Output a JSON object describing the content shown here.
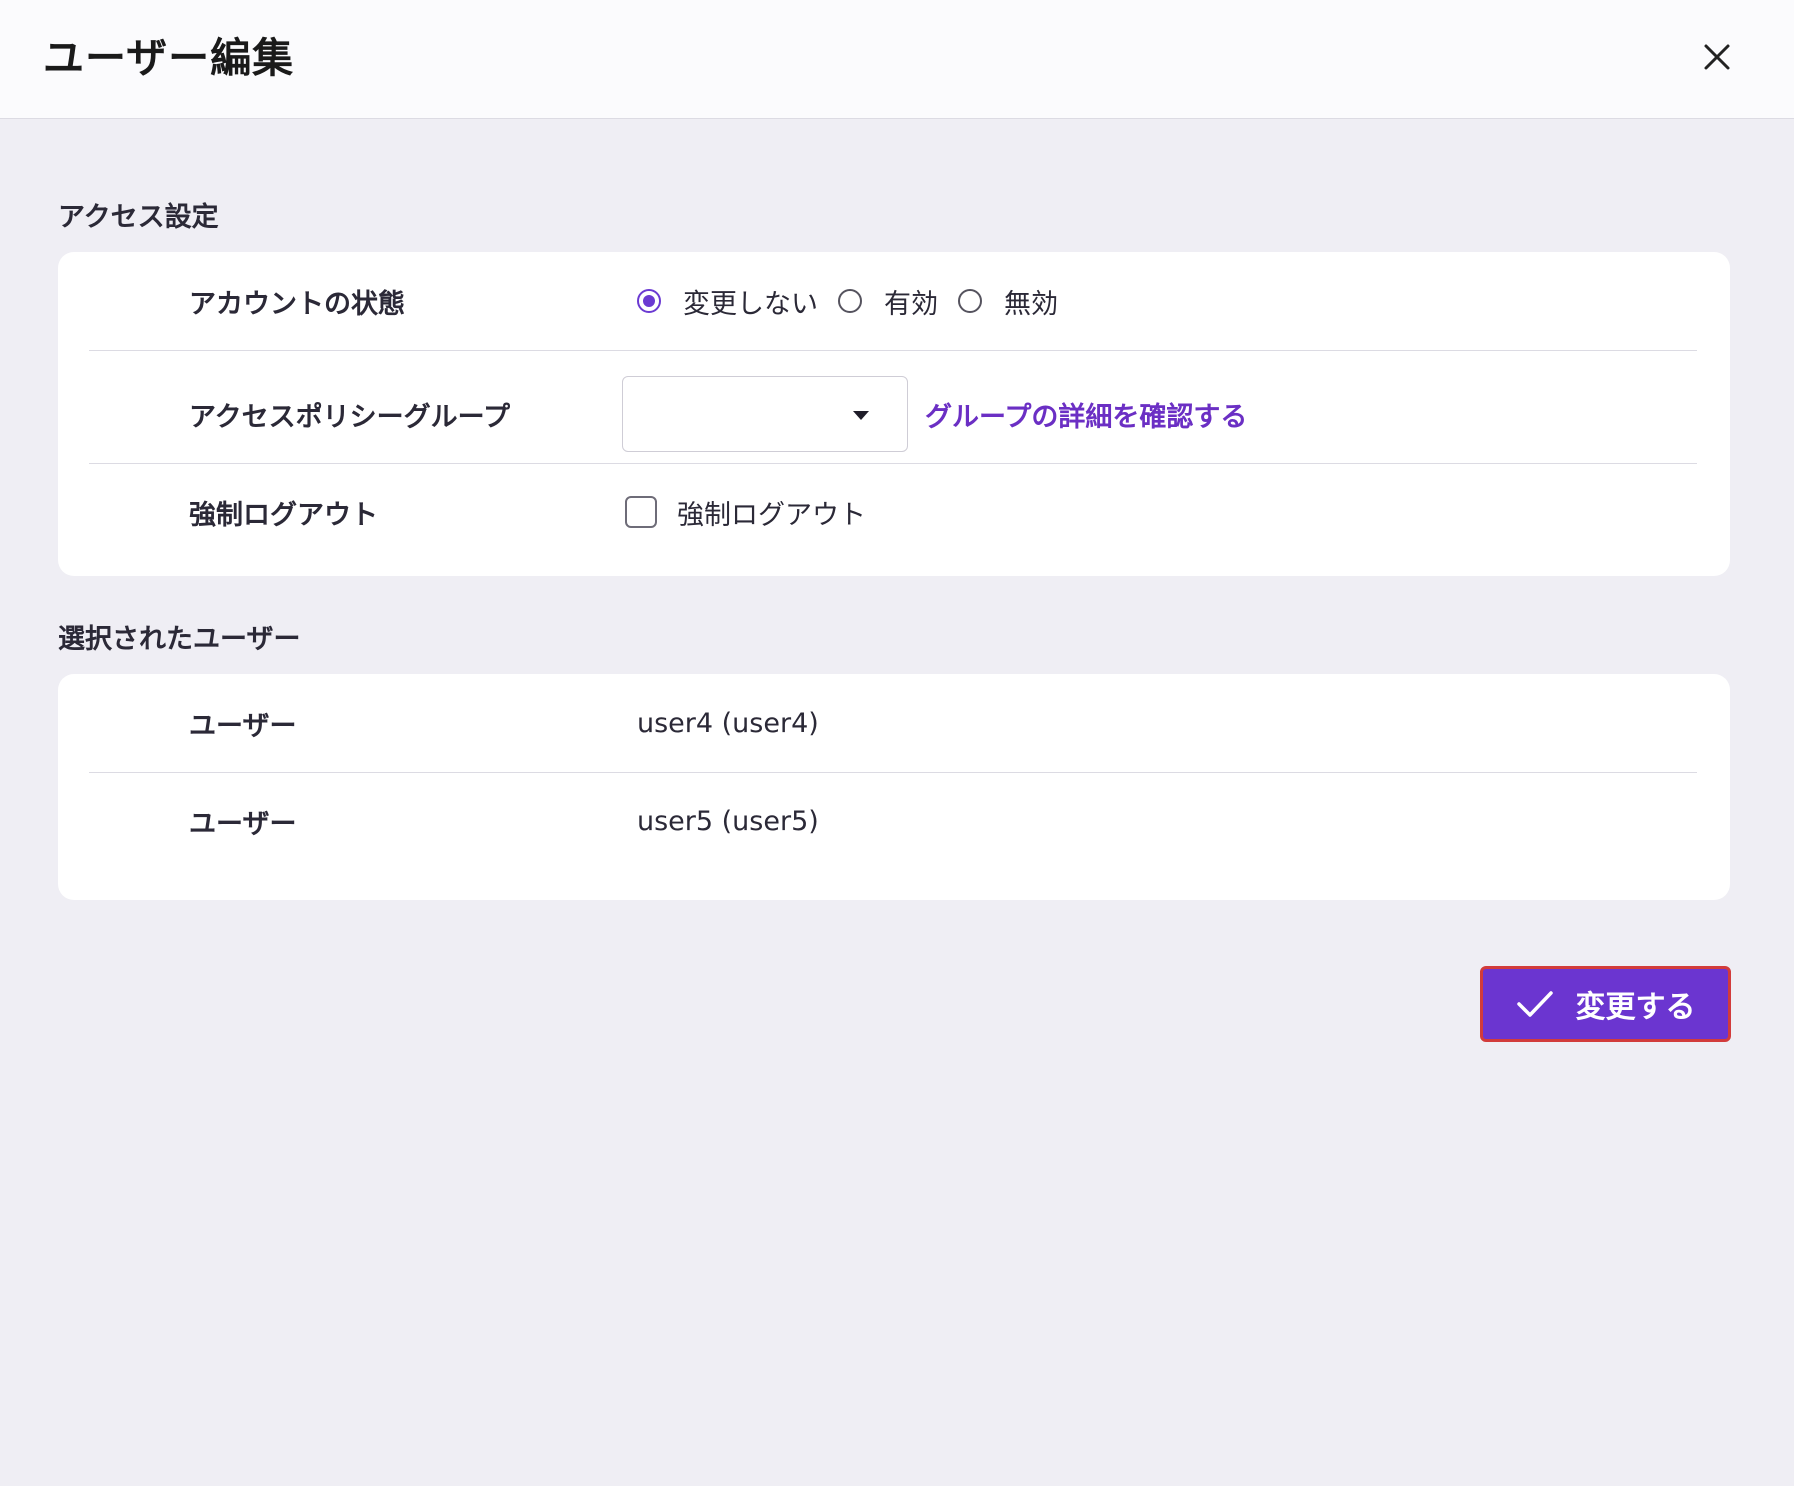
{
  "dialog": {
    "title": "ユーザー編集",
    "close_icon": "close-icon"
  },
  "access_settings": {
    "section_title": "アクセス設定",
    "account_status": {
      "label": "アカウントの状態",
      "options": [
        {
          "label": "変更しない",
          "checked": true
        },
        {
          "label": "有効",
          "checked": false
        },
        {
          "label": "無効",
          "checked": false
        }
      ]
    },
    "access_policy_group": {
      "label": "アクセスポリシーグループ",
      "selected_value": "",
      "link_text": "グループの詳細を確認する"
    },
    "force_logout": {
      "label": "強制ログアウト",
      "checkbox_label": "強制ログアウト",
      "checked": false
    }
  },
  "selected_users": {
    "section_title": "選択されたユーザー",
    "rows": [
      {
        "label": "ユーザー",
        "value": "user4 (user4)"
      },
      {
        "label": "ユーザー",
        "value": "user5 (user5)"
      }
    ]
  },
  "actions": {
    "submit_label": "変更する",
    "submit_icon": "check-icon",
    "accent_color": "#6b35d0"
  }
}
